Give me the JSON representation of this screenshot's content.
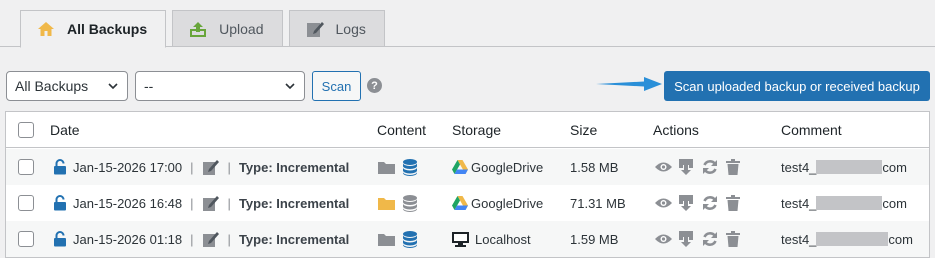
{
  "tabs": [
    {
      "label": "All Backups",
      "icon": "home-icon",
      "active": true
    },
    {
      "label": "Upload",
      "icon": "upload-icon",
      "active": false
    },
    {
      "label": "Logs",
      "icon": "log-edit-icon",
      "active": false
    }
  ],
  "filter": {
    "type_select": "All Backups",
    "second_select": "--",
    "scan_label": "Scan",
    "help_glyph": "?",
    "scan_uploaded_label": "Scan uploaded backup or received backup"
  },
  "table": {
    "headers": {
      "date": "Date",
      "content": "Content",
      "storage": "Storage",
      "size": "Size",
      "actions": "Actions",
      "comment": "Comment"
    },
    "rows": [
      {
        "date": "Jan-15-2026 17:00",
        "type": "Type: Incremental",
        "storage": "GoogleDrive",
        "storage_icon": "google-drive-icon",
        "size": "1.58 MB",
        "comment_prefix": "test4_",
        "comment_suffix": "com",
        "folder_color": "#8c8f94",
        "db_color": "#2271b1"
      },
      {
        "date": "Jan-15-2026 16:48",
        "type": "Type: Incremental",
        "storage": "GoogleDrive",
        "storage_icon": "google-drive-icon",
        "size": "71.31 MB",
        "comment_prefix": "test4_",
        "comment_suffix": "com",
        "folder_color": "#f0b849",
        "db_color": "#8c8f94"
      },
      {
        "date": "Jan-15-2026 01:18",
        "type": "Type: Incremental",
        "storage": "Localhost",
        "storage_icon": "monitor-icon",
        "size": "1.59 MB",
        "comment_prefix": "test4_",
        "comment_suffix": "com",
        "folder_color": "#8c8f94",
        "db_color": "#2271b1"
      }
    ]
  },
  "colors": {
    "accent": "#2271b1",
    "lock": "#2271b1",
    "icon_gray": "#8c8f94"
  }
}
